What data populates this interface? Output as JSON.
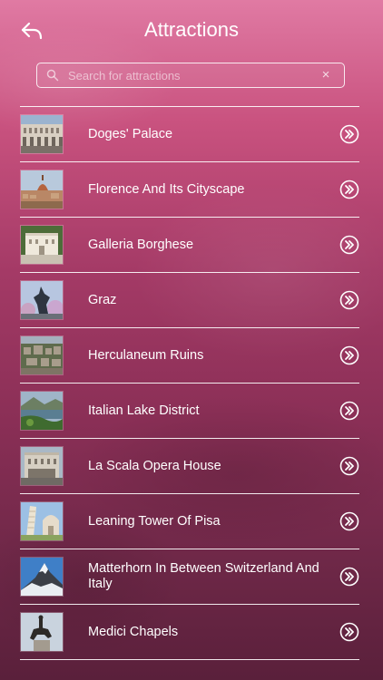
{
  "header": {
    "title": "Attractions",
    "back_icon": "back-arrow-icon"
  },
  "search": {
    "placeholder": "Search for attractions",
    "value": "",
    "clear_symbol": "×"
  },
  "attractions": [
    {
      "name": "Doges' Palace",
      "thumb": "palace-photo"
    },
    {
      "name": "Florence And Its Cityscape",
      "thumb": "cityscape-photo"
    },
    {
      "name": "Galleria Borghese",
      "thumb": "villa-photo"
    },
    {
      "name": "Graz",
      "thumb": "statue-photo"
    },
    {
      "name": "Herculaneum Ruins",
      "thumb": "ruins-photo"
    },
    {
      "name": "Italian Lake District",
      "thumb": "lake-photo"
    },
    {
      "name": "La Scala Opera House",
      "thumb": "opera-house-photo"
    },
    {
      "name": "Leaning Tower Of Pisa",
      "thumb": "tower-photo"
    },
    {
      "name": "Matterhorn In Between Switzerland And Italy",
      "thumb": "mountain-photo"
    },
    {
      "name": "Medici Chapels",
      "thumb": "equestrian-statue-photo"
    }
  ],
  "colors": {
    "accent": "#ffffff",
    "background_top": "#e07aa3",
    "background_bottom": "#5a203b"
  }
}
